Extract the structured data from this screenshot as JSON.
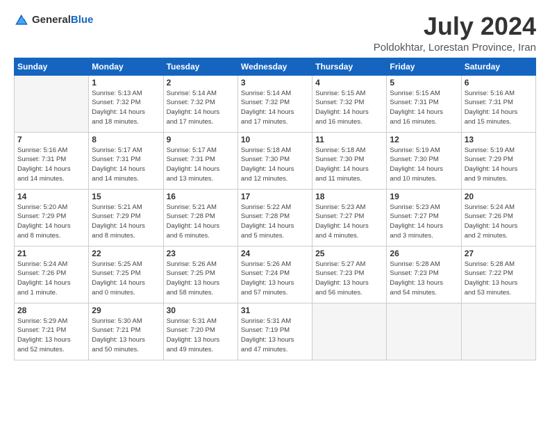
{
  "logo": {
    "general": "General",
    "blue": "Blue"
  },
  "title": "July 2024",
  "location": "Poldokhtar, Lorestan Province, Iran",
  "days_of_week": [
    "Sunday",
    "Monday",
    "Tuesday",
    "Wednesday",
    "Thursday",
    "Friday",
    "Saturday"
  ],
  "weeks": [
    [
      {
        "day": "",
        "info": ""
      },
      {
        "day": "1",
        "info": "Sunrise: 5:13 AM\nSunset: 7:32 PM\nDaylight: 14 hours\nand 18 minutes."
      },
      {
        "day": "2",
        "info": "Sunrise: 5:14 AM\nSunset: 7:32 PM\nDaylight: 14 hours\nand 17 minutes."
      },
      {
        "day": "3",
        "info": "Sunrise: 5:14 AM\nSunset: 7:32 PM\nDaylight: 14 hours\nand 17 minutes."
      },
      {
        "day": "4",
        "info": "Sunrise: 5:15 AM\nSunset: 7:32 PM\nDaylight: 14 hours\nand 16 minutes."
      },
      {
        "day": "5",
        "info": "Sunrise: 5:15 AM\nSunset: 7:31 PM\nDaylight: 14 hours\nand 16 minutes."
      },
      {
        "day": "6",
        "info": "Sunrise: 5:16 AM\nSunset: 7:31 PM\nDaylight: 14 hours\nand 15 minutes."
      }
    ],
    [
      {
        "day": "7",
        "info": "Sunrise: 5:16 AM\nSunset: 7:31 PM\nDaylight: 14 hours\nand 14 minutes."
      },
      {
        "day": "8",
        "info": "Sunrise: 5:17 AM\nSunset: 7:31 PM\nDaylight: 14 hours\nand 14 minutes."
      },
      {
        "day": "9",
        "info": "Sunrise: 5:17 AM\nSunset: 7:31 PM\nDaylight: 14 hours\nand 13 minutes."
      },
      {
        "day": "10",
        "info": "Sunrise: 5:18 AM\nSunset: 7:30 PM\nDaylight: 14 hours\nand 12 minutes."
      },
      {
        "day": "11",
        "info": "Sunrise: 5:18 AM\nSunset: 7:30 PM\nDaylight: 14 hours\nand 11 minutes."
      },
      {
        "day": "12",
        "info": "Sunrise: 5:19 AM\nSunset: 7:30 PM\nDaylight: 14 hours\nand 10 minutes."
      },
      {
        "day": "13",
        "info": "Sunrise: 5:19 AM\nSunset: 7:29 PM\nDaylight: 14 hours\nand 9 minutes."
      }
    ],
    [
      {
        "day": "14",
        "info": "Sunrise: 5:20 AM\nSunset: 7:29 PM\nDaylight: 14 hours\nand 8 minutes."
      },
      {
        "day": "15",
        "info": "Sunrise: 5:21 AM\nSunset: 7:29 PM\nDaylight: 14 hours\nand 8 minutes."
      },
      {
        "day": "16",
        "info": "Sunrise: 5:21 AM\nSunset: 7:28 PM\nDaylight: 14 hours\nand 6 minutes."
      },
      {
        "day": "17",
        "info": "Sunrise: 5:22 AM\nSunset: 7:28 PM\nDaylight: 14 hours\nand 5 minutes."
      },
      {
        "day": "18",
        "info": "Sunrise: 5:23 AM\nSunset: 7:27 PM\nDaylight: 14 hours\nand 4 minutes."
      },
      {
        "day": "19",
        "info": "Sunrise: 5:23 AM\nSunset: 7:27 PM\nDaylight: 14 hours\nand 3 minutes."
      },
      {
        "day": "20",
        "info": "Sunrise: 5:24 AM\nSunset: 7:26 PM\nDaylight: 14 hours\nand 2 minutes."
      }
    ],
    [
      {
        "day": "21",
        "info": "Sunrise: 5:24 AM\nSunset: 7:26 PM\nDaylight: 14 hours\nand 1 minute."
      },
      {
        "day": "22",
        "info": "Sunrise: 5:25 AM\nSunset: 7:25 PM\nDaylight: 14 hours\nand 0 minutes."
      },
      {
        "day": "23",
        "info": "Sunrise: 5:26 AM\nSunset: 7:25 PM\nDaylight: 13 hours\nand 58 minutes."
      },
      {
        "day": "24",
        "info": "Sunrise: 5:26 AM\nSunset: 7:24 PM\nDaylight: 13 hours\nand 57 minutes."
      },
      {
        "day": "25",
        "info": "Sunrise: 5:27 AM\nSunset: 7:23 PM\nDaylight: 13 hours\nand 56 minutes."
      },
      {
        "day": "26",
        "info": "Sunrise: 5:28 AM\nSunset: 7:23 PM\nDaylight: 13 hours\nand 54 minutes."
      },
      {
        "day": "27",
        "info": "Sunrise: 5:28 AM\nSunset: 7:22 PM\nDaylight: 13 hours\nand 53 minutes."
      }
    ],
    [
      {
        "day": "28",
        "info": "Sunrise: 5:29 AM\nSunset: 7:21 PM\nDaylight: 13 hours\nand 52 minutes."
      },
      {
        "day": "29",
        "info": "Sunrise: 5:30 AM\nSunset: 7:21 PM\nDaylight: 13 hours\nand 50 minutes."
      },
      {
        "day": "30",
        "info": "Sunrise: 5:31 AM\nSunset: 7:20 PM\nDaylight: 13 hours\nand 49 minutes."
      },
      {
        "day": "31",
        "info": "Sunrise: 5:31 AM\nSunset: 7:19 PM\nDaylight: 13 hours\nand 47 minutes."
      },
      {
        "day": "",
        "info": ""
      },
      {
        "day": "",
        "info": ""
      },
      {
        "day": "",
        "info": ""
      }
    ]
  ]
}
